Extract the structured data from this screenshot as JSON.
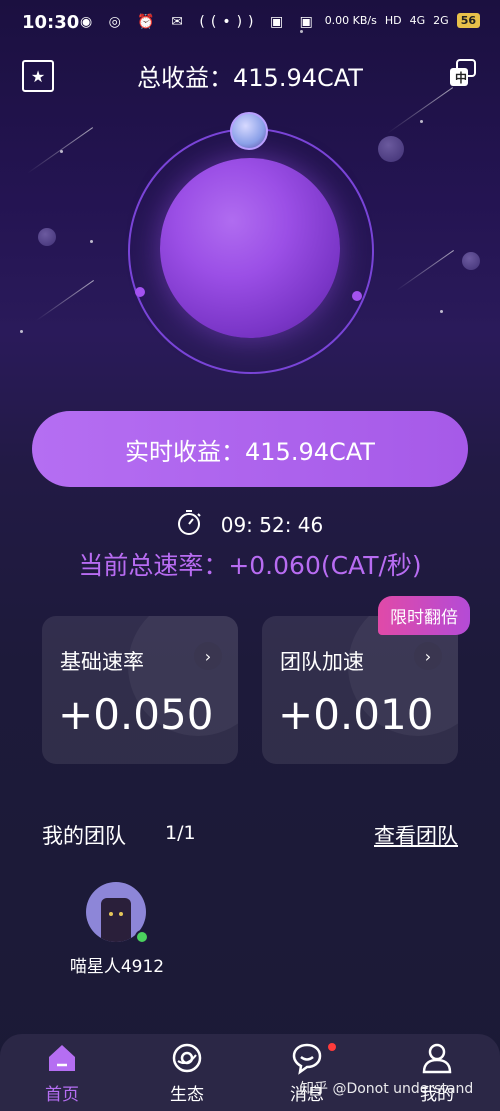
{
  "status_bar": {
    "time": "10:30",
    "speed": "0.00 KB/s",
    "network1": "4G",
    "network2": "2G",
    "battery": "56"
  },
  "header": {
    "title": "总收益：415.94CAT",
    "right_icon_label": "中"
  },
  "main": {
    "realtime_button": "实时收益：415.94CAT",
    "timer": "09: 52: 46",
    "rate": "当前总速率：+0.060(CAT/秒)",
    "badge": "限时翻倍",
    "cards": [
      {
        "label": "基础速率",
        "value": "+0.050"
      },
      {
        "label": "团队加速",
        "value": "+0.010"
      }
    ]
  },
  "team": {
    "title": "我的团队",
    "count": "1/1",
    "view_link": "查看团队",
    "members": [
      {
        "name": "喵星人4912"
      }
    ]
  },
  "tabs": [
    {
      "label": "首页",
      "icon": "home-icon",
      "active": true
    },
    {
      "label": "生态",
      "icon": "ecosystem-icon",
      "active": false
    },
    {
      "label": "消息",
      "icon": "message-icon",
      "active": false
    },
    {
      "label": "我的",
      "icon": "profile-icon",
      "active": false
    }
  ],
  "watermark": "知乎 @Donot understand",
  "colors": {
    "accent": "#b56ef2",
    "rate_text": "#b86cf2",
    "badge": "#e04aa8",
    "tab_active": "#b56ef2",
    "online": "#4bd15e"
  }
}
